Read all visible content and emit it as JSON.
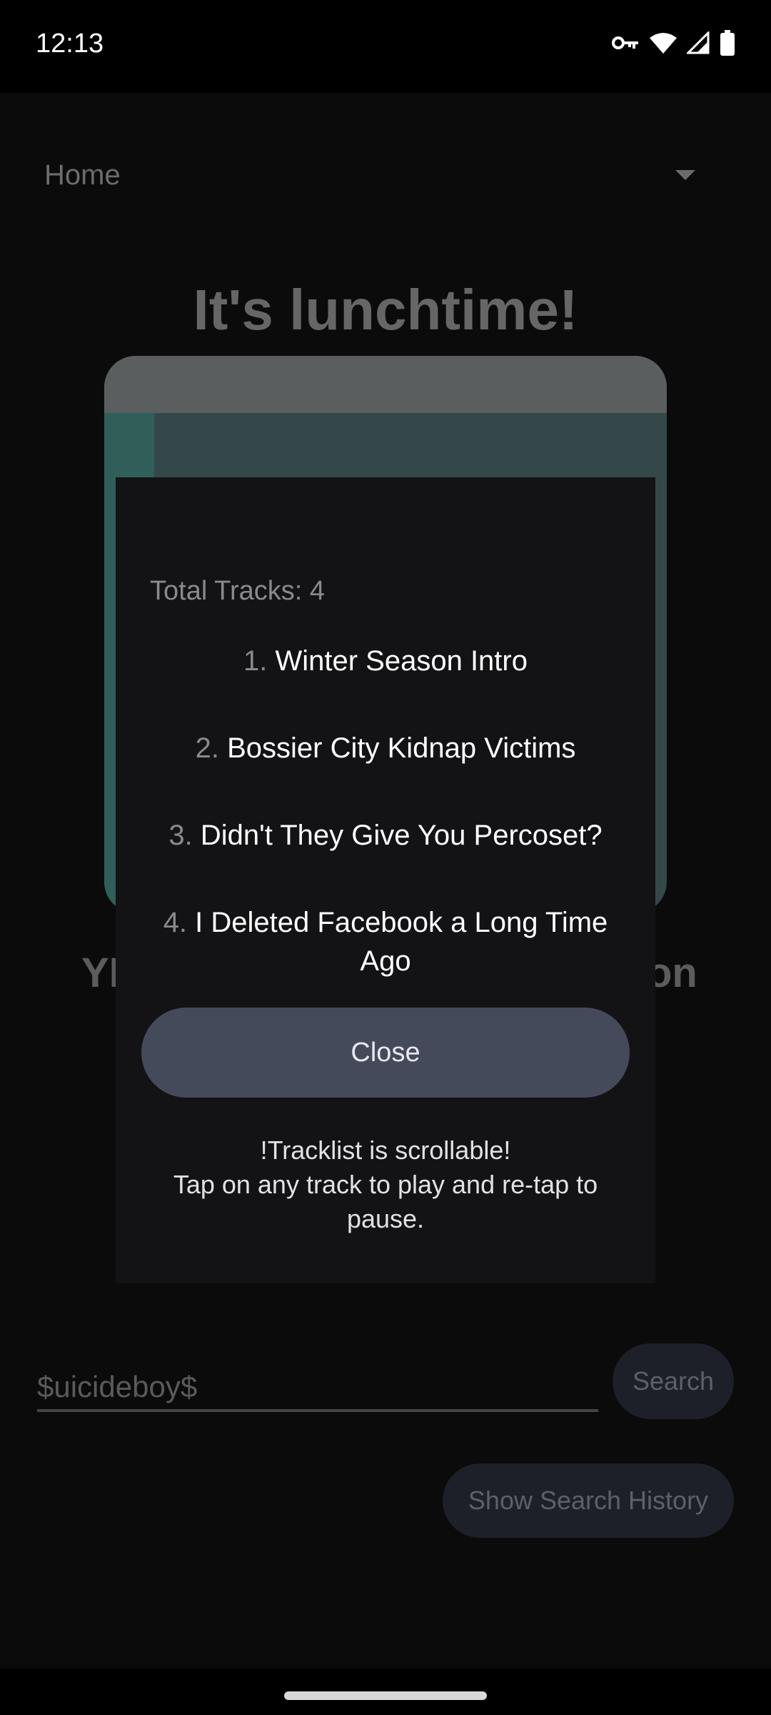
{
  "status_bar": {
    "time": "12:13",
    "icons": [
      "key-icon",
      "wifi-icon",
      "signal-icon",
      "battery-icon"
    ]
  },
  "app": {
    "nav_dropdown": {
      "selected": "Home"
    },
    "greeting": "It's lunchtime!",
    "album_title_left": "YI",
    "album_title_right": "on",
    "search": {
      "value": "$uicideboy$",
      "button_label": "Search"
    },
    "history_button_label": "Show Search History"
  },
  "dialog": {
    "total_tracks": "Total Tracks: 4",
    "tracks": [
      {
        "num": "1.",
        "title": "Winter Season Intro"
      },
      {
        "num": "2.",
        "title": "Bossier City Kidnap Victims"
      },
      {
        "num": "3.",
        "title": "Didn't They Give You Percoset?"
      },
      {
        "num": "4.",
        "title": "I Deleted Facebook a Long Time Ago"
      }
    ],
    "close_label": "Close",
    "hint_line1": "!Tracklist is scrollable!",
    "hint_line2": "Tap on any track to play and re-tap to pause."
  },
  "colors": {
    "background": "#0b0b0c",
    "dialog_bg": "#131315",
    "close_button": "#454a5b",
    "secondary_text": "#8a8a8c"
  }
}
